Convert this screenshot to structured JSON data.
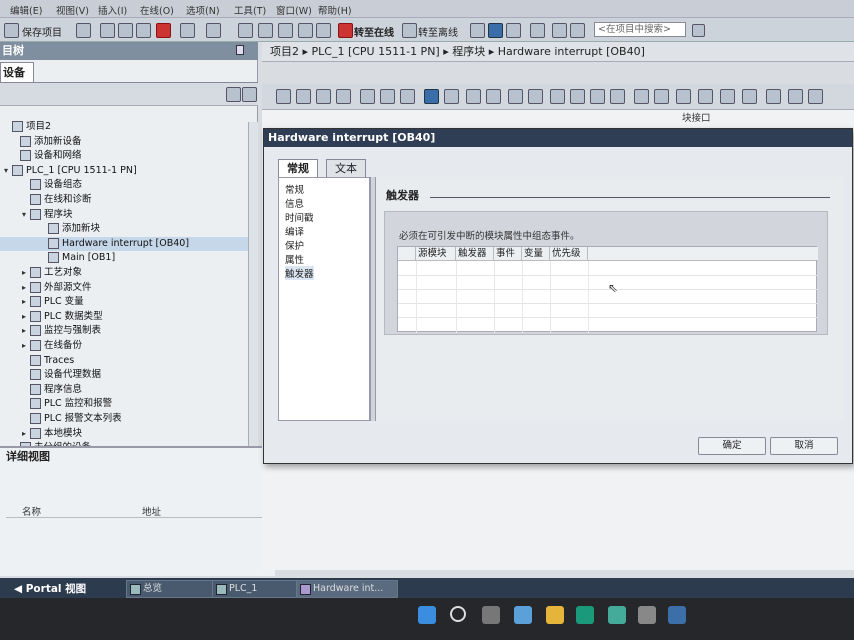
{
  "menu": [
    "编辑(E)",
    "视图(V)",
    "插入(I)",
    "在线(O)",
    "选项(N)",
    "工具(T)",
    "窗口(W)",
    "帮助(H)"
  ],
  "toolbar": {
    "save_project": "保存项目",
    "go_online": "转至在线",
    "go_offline": "转至离线",
    "search_placeholder": "<在项目中搜索>"
  },
  "left_pane": {
    "title": "目树",
    "tab": "设备",
    "tree": [
      {
        "label": "项目2",
        "level": 0
      },
      {
        "label": "添加新设备",
        "level": 1
      },
      {
        "label": "设备和网络",
        "level": 1
      },
      {
        "label": "PLC_1 [CPU 1511-1 PN]",
        "level": 0
      },
      {
        "label": "设备组态",
        "level": 2
      },
      {
        "label": "在线和诊断",
        "level": 2
      },
      {
        "label": "程序块",
        "level": 2
      },
      {
        "label": "添加新块",
        "level": 3
      },
      {
        "label": "Hardware interrupt [OB40]",
        "level": 3
      },
      {
        "label": "Main [OB1]",
        "level": 3
      },
      {
        "label": "工艺对象",
        "level": 2
      },
      {
        "label": "外部源文件",
        "level": 2
      },
      {
        "label": "PLC 变量",
        "level": 2
      },
      {
        "label": "PLC 数据类型",
        "level": 2
      },
      {
        "label": "监控与强制表",
        "level": 2
      },
      {
        "label": "在线备份",
        "level": 2
      },
      {
        "label": "Traces",
        "level": 2
      },
      {
        "label": "设备代理数据",
        "level": 2
      },
      {
        "label": "程序信息",
        "level": 2
      },
      {
        "label": "PLC 监控和报警",
        "level": 2
      },
      {
        "label": "PLC 报警文本列表",
        "level": 2
      },
      {
        "label": "本地模块",
        "level": 2
      },
      {
        "label": "未分组的设备",
        "level": 1
      }
    ]
  },
  "detail_view": {
    "title": "详细视图",
    "col_name": "名称",
    "col_address": "地址"
  },
  "editor": {
    "breadcrumb": "项目2 ▸ PLC_1 [CPU 1511-1 PN] ▸ 程序块 ▸ Hardware interrupt [OB40]",
    "block_interface": "块接口"
  },
  "dialog": {
    "title": "Hardware interrupt [OB40]",
    "tabs": [
      "常规",
      "文本"
    ],
    "nav": [
      "常规",
      "信息",
      "时间戳",
      "编译",
      "保护",
      "属性",
      "触发器"
    ],
    "section_title": "触发器",
    "note": "必须在可引发中断的模块属性中组态事件。",
    "columns": [
      "源模块",
      "触发器",
      "事件",
      "变量",
      "优先级"
    ],
    "ok": "确定",
    "cancel": "取消"
  },
  "portal_bar": {
    "portal": "Portal 视图",
    "tabs": [
      "总览",
      "PLC_1",
      "Hardware int..."
    ]
  }
}
